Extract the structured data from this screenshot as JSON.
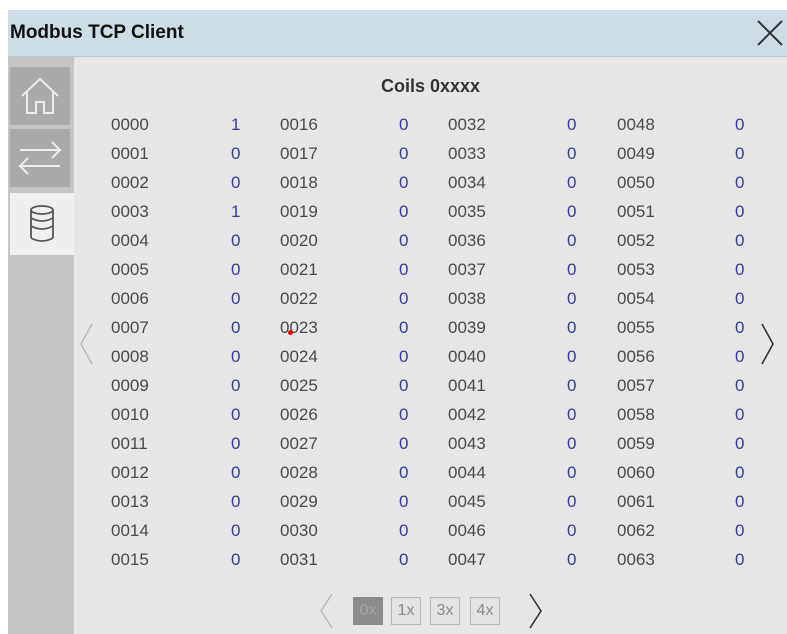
{
  "window": {
    "title": "Modbus TCP Client"
  },
  "icons": {
    "close": "close-icon",
    "home": "home-icon",
    "transfer": "transfer-arrows-icon",
    "data": "database-icon",
    "prev": "chevron-left-icon",
    "next": "chevron-right-icon"
  },
  "content": {
    "title": "Coils 0xxxx",
    "columns": [
      {
        "addresses": [
          "0000",
          "0001",
          "0002",
          "0003",
          "0004",
          "0005",
          "0006",
          "0007",
          "0008",
          "0009",
          "0010",
          "0011",
          "0012",
          "0013",
          "0014",
          "0015"
        ],
        "values": [
          "1",
          "0",
          "0",
          "1",
          "0",
          "0",
          "0",
          "0",
          "0",
          "0",
          "0",
          "0",
          "0",
          "0",
          "0",
          "0"
        ]
      },
      {
        "addresses": [
          "0016",
          "0017",
          "0018",
          "0019",
          "0020",
          "0021",
          "0022",
          "0023",
          "0024",
          "0025",
          "0026",
          "0027",
          "0028",
          "0029",
          "0030",
          "0031"
        ],
        "values": [
          "0",
          "0",
          "0",
          "0",
          "0",
          "0",
          "0",
          "0",
          "0",
          "0",
          "0",
          "0",
          "0",
          "0",
          "0",
          "0"
        ]
      },
      {
        "addresses": [
          "0032",
          "0033",
          "0034",
          "0035",
          "0036",
          "0037",
          "0038",
          "0039",
          "0040",
          "0041",
          "0042",
          "0043",
          "0044",
          "0045",
          "0046",
          "0047"
        ],
        "values": [
          "0",
          "0",
          "0",
          "0",
          "0",
          "0",
          "0",
          "0",
          "0",
          "0",
          "0",
          "0",
          "0",
          "0",
          "0",
          "0"
        ]
      },
      {
        "addresses": [
          "0048",
          "0049",
          "0050",
          "0051",
          "0052",
          "0053",
          "0054",
          "0055",
          "0056",
          "0057",
          "0058",
          "0059",
          "0060",
          "0061",
          "0062",
          "0063"
        ],
        "values": [
          "0",
          "0",
          "0",
          "0",
          "0",
          "0",
          "0",
          "0",
          "0",
          "0",
          "0",
          "0",
          "0",
          "0",
          "0",
          "0"
        ]
      }
    ]
  },
  "pages": [
    "0x",
    "1x",
    "3x",
    "4x"
  ],
  "active_page": "0x",
  "colors": {
    "titlebar": "#ccdde8",
    "value": "#2e3f9e",
    "sidebar": "#c4c4c4"
  }
}
